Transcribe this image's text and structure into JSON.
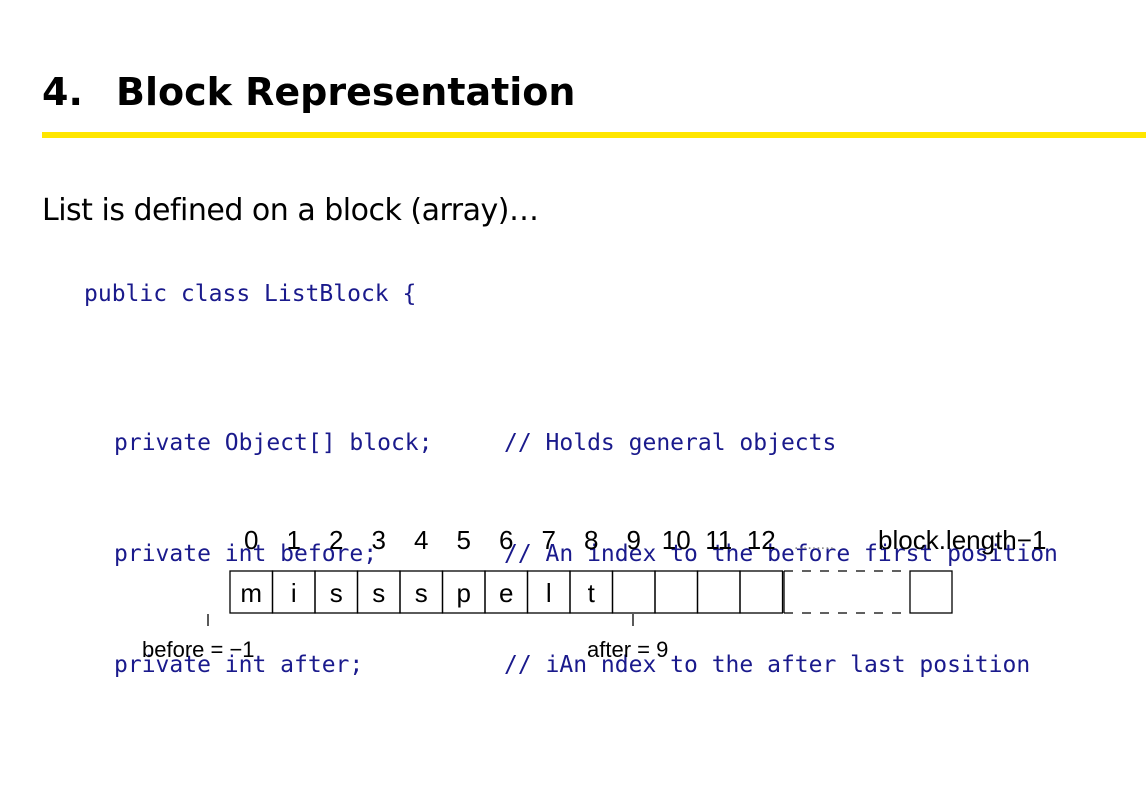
{
  "slide": {
    "number": "4.",
    "title": "Block Representation",
    "accent_color": "#ffe600",
    "intro": "List is defined on a block (array)…"
  },
  "code": {
    "color": "#1a1a8c",
    "class_decl": "public class ListBlock {",
    "fields": [
      {
        "decl": "private Object[] block;",
        "comment": "// Holds general objects"
      },
      {
        "decl": "private int before;",
        "comment": "// An index to the before first position"
      },
      {
        "decl": "private int after;",
        "comment": "// iAn ndex to the after last position"
      }
    ]
  },
  "diagram": {
    "indices": [
      "0",
      "1",
      "2",
      "3",
      "4",
      "5",
      "6",
      "7",
      "8",
      "9",
      "10",
      "11",
      "12"
    ],
    "ellipsis": ".........",
    "last_index_label": "block.length−1",
    "cells": [
      "m",
      "i",
      "s",
      "s",
      "s",
      "p",
      "e",
      "l",
      "t",
      "",
      "",
      "",
      ""
    ],
    "before_label": "before = −1",
    "after_label": "after = 9"
  }
}
